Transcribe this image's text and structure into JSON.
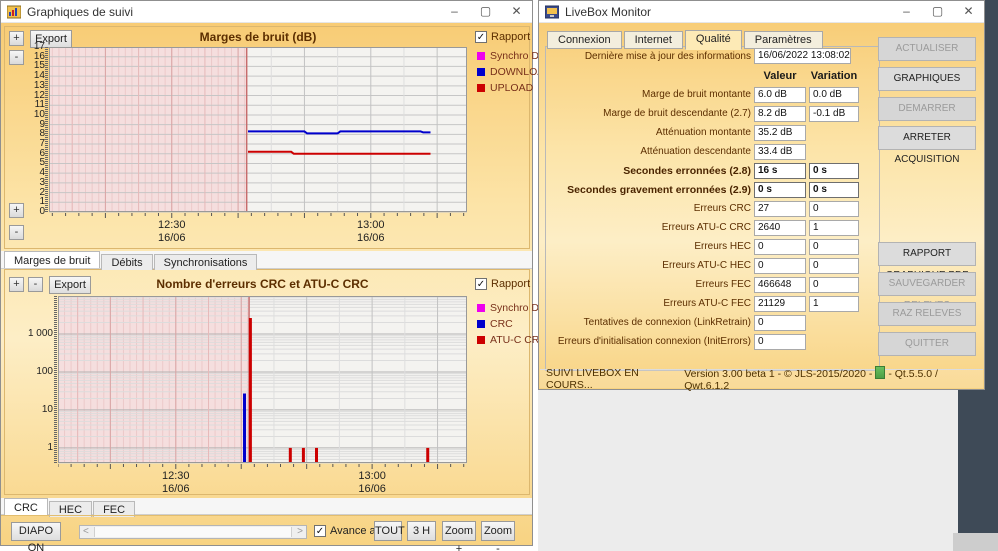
{
  "left_window": {
    "title": "Graphiques de suivi",
    "titlebar_controls": {
      "minimize": "–",
      "maximize": "▢",
      "close": "✕"
    },
    "charts_tabs": [
      {
        "label": "Marges de bruit",
        "active": true
      },
      {
        "label": "Débits",
        "active": false
      },
      {
        "label": "Synchronisations",
        "active": false
      }
    ],
    "errors_tabs": [
      {
        "label": "CRC",
        "active": true
      },
      {
        "label": "HEC",
        "active": false
      },
      {
        "label": "FEC",
        "active": false
      }
    ],
    "controls": {
      "plus": "+",
      "minus": "-",
      "export": "Export",
      "rapport": "Rapport",
      "rapport_checked": true,
      "diapo": "DIAPO ON",
      "avance_auto": "Avance auto",
      "avance_auto_checked": true,
      "tout": "TOUT",
      "three_h": "3 H",
      "zoom_in": "Zoom +",
      "zoom_out": "Zoom -"
    }
  },
  "chart_data": [
    {
      "type": "line",
      "title": "Marges de bruit (dB)",
      "yscale": "linear",
      "ylim": [
        0,
        17
      ],
      "y_tick_step": 1,
      "xlim": [
        731.5,
        794.5
      ],
      "x_unit": "minutes since midnight (16/06)",
      "x_ticks": [
        {
          "x": 750,
          "label": "12:30",
          "sublabel": "16/06"
        },
        {
          "x": 780,
          "label": "13:00",
          "sublabel": "16/06"
        }
      ],
      "shaded_no_data_region": [
        731.5,
        761.3
      ],
      "grid": true,
      "legend_position": "right",
      "legend": [
        {
          "name": "Synchro DSL",
          "color": "#ee00ee"
        },
        {
          "name": "DOWNLOAD",
          "color": "#0000cc"
        },
        {
          "name": "UPLOAD",
          "color": "#cc0000"
        }
      ],
      "series": [
        {
          "name": "DOWNLOAD",
          "color": "#0000cc",
          "unit": "dB",
          "points": [
            [
              761.5,
              8.3
            ],
            [
              770,
              8.3
            ],
            [
              770.4,
              8.1
            ],
            [
              775,
              8.1
            ],
            [
              775.4,
              8.3
            ],
            [
              787.5,
              8.3
            ],
            [
              787.9,
              8.2
            ],
            [
              789,
              8.2
            ]
          ]
        },
        {
          "name": "UPLOAD",
          "color": "#cc0000",
          "unit": "dB",
          "points": [
            [
              761.5,
              6.2
            ],
            [
              768,
              6.2
            ],
            [
              768.4,
              6.0
            ],
            [
              789,
              6.0
            ]
          ]
        },
        {
          "name": "Synchro DSL",
          "color": "#ee00ee",
          "points": []
        }
      ]
    },
    {
      "type": "bar",
      "title": "Nombre d'erreurs CRC et ATU-C CRC",
      "yscale": "log",
      "ylim": [
        0.4,
        10000
      ],
      "y_ticks": [
        {
          "v": 1,
          "label": "1"
        },
        {
          "v": 10,
          "label": "10"
        },
        {
          "v": 100,
          "label": "100"
        },
        {
          "v": 1000,
          "label": "1 000"
        }
      ],
      "xlim": [
        732,
        794.5
      ],
      "x_unit": "minutes since midnight (16/06)",
      "x_ticks": [
        {
          "x": 750,
          "label": "12:30",
          "sublabel": "16/06"
        },
        {
          "x": 780,
          "label": "13:00",
          "sublabel": "16/06"
        }
      ],
      "shaded_no_data_region": [
        732,
        761.2
      ],
      "grid": true,
      "legend_position": "right",
      "legend": [
        {
          "name": "Synchro DSL",
          "color": "#ee00ee"
        },
        {
          "name": "CRC",
          "color": "#0000cc"
        },
        {
          "name": "ATU-C CRC",
          "color": "#cc0000"
        }
      ],
      "series": [
        {
          "name": "CRC",
          "color": "#0000cc",
          "bars": [
            [
              760.5,
              27
            ]
          ]
        },
        {
          "name": "ATU-C CRC",
          "color": "#cc0000",
          "bars": [
            [
              761.4,
              2640
            ],
            [
              767.5,
              1
            ],
            [
              769.5,
              1
            ],
            [
              771.5,
              1
            ],
            [
              788.5,
              1
            ]
          ]
        },
        {
          "name": "Synchro DSL",
          "color": "#ee00ee",
          "bars": []
        }
      ]
    }
  ],
  "right_window": {
    "title": "LiveBox Monitor",
    "titlebar_controls": {
      "minimize": "–",
      "maximize": "▢",
      "close": "✕"
    },
    "tabs": [
      {
        "label": "Connexion",
        "active": false
      },
      {
        "label": "Internet",
        "active": false
      },
      {
        "label": "Qualité",
        "active": true
      },
      {
        "label": "Paramètres",
        "active": false
      }
    ],
    "last_update": {
      "label": "Dernière mise à jour des informations",
      "value": "16/06/2022 13:08:02"
    },
    "columns": {
      "valeur": "Valeur",
      "variation": "Variation"
    },
    "rows": [
      {
        "label": "Marge de bruit montante",
        "valeur": "6.0 dB",
        "variation": "0.0 dB",
        "bold": false
      },
      {
        "label": "Marge de bruit descendante (2.7)",
        "valeur": "8.2 dB",
        "variation": "-0.1 dB",
        "bold": false
      },
      {
        "label": "Atténuation montante",
        "valeur": "35.2 dB",
        "variation": null,
        "bold": false
      },
      {
        "label": "Atténuation descendante",
        "valeur": "33.4 dB",
        "variation": null,
        "bold": false
      },
      {
        "label": "Secondes erronnées (2.8)",
        "valeur": "16 s",
        "variation": "0 s",
        "bold": true
      },
      {
        "label": "Secondes gravement erronnées (2.9)",
        "valeur": "0 s",
        "variation": "0 s",
        "bold": true
      },
      {
        "label": "Erreurs CRC",
        "valeur": "27",
        "variation": "0",
        "bold": false
      },
      {
        "label": "Erreurs ATU-C CRC",
        "valeur": "2640",
        "variation": "1",
        "bold": false
      },
      {
        "label": "Erreurs HEC",
        "valeur": "0",
        "variation": "0",
        "bold": false
      },
      {
        "label": "Erreurs ATU-C HEC",
        "valeur": "0",
        "variation": "0",
        "bold": false
      },
      {
        "label": "Erreurs FEC",
        "valeur": "466648",
        "variation": "0",
        "bold": false
      },
      {
        "label": "Erreurs ATU-C FEC",
        "valeur": "21129",
        "variation": "1",
        "bold": false
      },
      {
        "label": "Tentatives de connexion (LinkRetrain)",
        "valeur": "0",
        "variation": null,
        "bold": false
      },
      {
        "label": "Erreurs d'initialisation connexion (InitErrors)",
        "valeur": "0",
        "variation": null,
        "bold": false
      }
    ],
    "side_buttons": [
      {
        "label": "ACTUALISER",
        "enabled": false
      },
      {
        "label": "GRAPHIQUES",
        "enabled": true
      },
      {
        "label": "DEMARRER ACQUISITION",
        "enabled": false
      },
      {
        "label": "ARRETER ACQUISITION",
        "enabled": true
      },
      {
        "label": "RAPPORT GRAPHIQUE PDF",
        "enabled": true
      },
      {
        "label": "SAUVEGARDER RELEVES",
        "enabled": false
      },
      {
        "label": "RAZ RELEVES",
        "enabled": false
      },
      {
        "label": "QUITTER",
        "enabled": false
      }
    ],
    "status": {
      "left": "SUIVI LIVEBOX EN COURS...",
      "right_before_icon": "Version 3.00 beta 1 - © JLS-2015/2020 -",
      "right_after_icon": "- Qt.5.5.0 / Qwt.6.1.2"
    }
  }
}
